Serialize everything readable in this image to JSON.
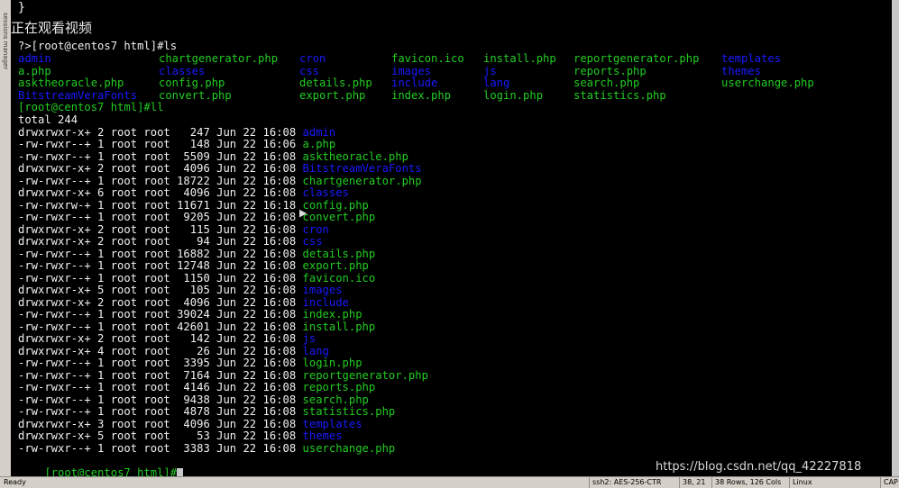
{
  "overlay_text": "正在观看视频",
  "left_strip_label": "sessions manager",
  "top_brace": "}",
  "prompt_ls": "?>[root@centos7 html]#ls",
  "ls_columns": [
    [
      {
        "t": "admin",
        "c": "b"
      },
      {
        "t": "a.php",
        "c": "g"
      },
      {
        "t": "asktheoracle.php",
        "c": "g"
      },
      {
        "t": "BitstreamVeraFonts",
        "c": "b"
      }
    ],
    [
      {
        "t": "chartgenerator.php",
        "c": "g"
      },
      {
        "t": "classes",
        "c": "b"
      },
      {
        "t": "config.php",
        "c": "g"
      },
      {
        "t": "convert.php",
        "c": "g"
      }
    ],
    [
      {
        "t": "cron",
        "c": "b"
      },
      {
        "t": "css",
        "c": "b"
      },
      {
        "t": "details.php",
        "c": "g"
      },
      {
        "t": "export.php",
        "c": "g"
      }
    ],
    [
      {
        "t": "favicon.ico",
        "c": "g"
      },
      {
        "t": "images",
        "c": "b"
      },
      {
        "t": "include",
        "c": "b"
      },
      {
        "t": "index.php",
        "c": "g"
      }
    ],
    [
      {
        "t": "install.php",
        "c": "g"
      },
      {
        "t": "js",
        "c": "b"
      },
      {
        "t": "lang",
        "c": "b"
      },
      {
        "t": "login.php",
        "c": "g"
      }
    ],
    [
      {
        "t": "reportgenerator.php",
        "c": "g"
      },
      {
        "t": "reports.php",
        "c": "g"
      },
      {
        "t": "search.php",
        "c": "g"
      },
      {
        "t": "statistics.php",
        "c": "g"
      }
    ],
    [
      {
        "t": "templates",
        "c": "b"
      },
      {
        "t": "themes",
        "c": "b"
      },
      {
        "t": "userchange.php",
        "c": "g"
      }
    ]
  ],
  "prompt_ll": "[root@centos7 html]#ll",
  "total": "total 244",
  "ll_rows": [
    {
      "perm": "drwxrwxr-x+",
      "links": "2",
      "user": "root",
      "group": "root",
      "size": "247",
      "date": "Jun 22 16:08",
      "name": "admin",
      "c": "b"
    },
    {
      "perm": "-rw-rwxr--+",
      "links": "1",
      "user": "root",
      "group": "root",
      "size": "148",
      "date": "Jun 22 16:06",
      "name": "a.php",
      "c": "g"
    },
    {
      "perm": "-rw-rwxr--+",
      "links": "1",
      "user": "root",
      "group": "root",
      "size": "5509",
      "date": "Jun 22 16:08",
      "name": "asktheoracle.php",
      "c": "g"
    },
    {
      "perm": "drwxrwxr-x+",
      "links": "2",
      "user": "root",
      "group": "root",
      "size": "4096",
      "date": "Jun 22 16:08",
      "name": "BitstreamVeraFonts",
      "c": "b"
    },
    {
      "perm": "-rw-rwxr--+",
      "links": "1",
      "user": "root",
      "group": "root",
      "size": "18722",
      "date": "Jun 22 16:08",
      "name": "chartgenerator.php",
      "c": "g"
    },
    {
      "perm": "drwxrwxr-x+",
      "links": "6",
      "user": "root",
      "group": "root",
      "size": "4096",
      "date": "Jun 22 16:08",
      "name": "classes",
      "c": "b"
    },
    {
      "perm": "-rw-rwxrw-+",
      "links": "1",
      "user": "root",
      "group": "root",
      "size": "11671",
      "date": "Jun 22 16:18",
      "name": "config.php",
      "c": "g"
    },
    {
      "perm": "-rw-rwxr--+",
      "links": "1",
      "user": "root",
      "group": "root",
      "size": "9205",
      "date": "Jun 22 16:08",
      "name": "convert.php",
      "c": "g"
    },
    {
      "perm": "drwxrwxr-x+",
      "links": "2",
      "user": "root",
      "group": "root",
      "size": "115",
      "date": "Jun 22 16:08",
      "name": "cron",
      "c": "b"
    },
    {
      "perm": "drwxrwxr-x+",
      "links": "2",
      "user": "root",
      "group": "root",
      "size": "94",
      "date": "Jun 22 16:08",
      "name": "css",
      "c": "b"
    },
    {
      "perm": "-rw-rwxr--+",
      "links": "1",
      "user": "root",
      "group": "root",
      "size": "16882",
      "date": "Jun 22 16:08",
      "name": "details.php",
      "c": "g"
    },
    {
      "perm": "-rw-rwxr--+",
      "links": "1",
      "user": "root",
      "group": "root",
      "size": "12748",
      "date": "Jun 22 16:08",
      "name": "export.php",
      "c": "g"
    },
    {
      "perm": "-rw-rwxr--+",
      "links": "1",
      "user": "root",
      "group": "root",
      "size": "1150",
      "date": "Jun 22 16:08",
      "name": "favicon.ico",
      "c": "g"
    },
    {
      "perm": "drwxrwxr-x+",
      "links": "5",
      "user": "root",
      "group": "root",
      "size": "105",
      "date": "Jun 22 16:08",
      "name": "images",
      "c": "b"
    },
    {
      "perm": "drwxrwxr-x+",
      "links": "2",
      "user": "root",
      "group": "root",
      "size": "4096",
      "date": "Jun 22 16:08",
      "name": "include",
      "c": "b"
    },
    {
      "perm": "-rw-rwxr--+",
      "links": "1",
      "user": "root",
      "group": "root",
      "size": "39024",
      "date": "Jun 22 16:08",
      "name": "index.php",
      "c": "g"
    },
    {
      "perm": "-rw-rwxr--+",
      "links": "1",
      "user": "root",
      "group": "root",
      "size": "42601",
      "date": "Jun 22 16:08",
      "name": "install.php",
      "c": "g"
    },
    {
      "perm": "drwxrwxr-x+",
      "links": "2",
      "user": "root",
      "group": "root",
      "size": "142",
      "date": "Jun 22 16:08",
      "name": "js",
      "c": "b"
    },
    {
      "perm": "drwxrwxr-x+",
      "links": "4",
      "user": "root",
      "group": "root",
      "size": "26",
      "date": "Jun 22 16:08",
      "name": "lang",
      "c": "b"
    },
    {
      "perm": "-rw-rwxr--+",
      "links": "1",
      "user": "root",
      "group": "root",
      "size": "3395",
      "date": "Jun 22 16:08",
      "name": "login.php",
      "c": "g"
    },
    {
      "perm": "-rw-rwxr--+",
      "links": "1",
      "user": "root",
      "group": "root",
      "size": "7164",
      "date": "Jun 22 16:08",
      "name": "reportgenerator.php",
      "c": "g"
    },
    {
      "perm": "-rw-rwxr--+",
      "links": "1",
      "user": "root",
      "group": "root",
      "size": "4146",
      "date": "Jun 22 16:08",
      "name": "reports.php",
      "c": "g"
    },
    {
      "perm": "-rw-rwxr--+",
      "links": "1",
      "user": "root",
      "group": "root",
      "size": "9438",
      "date": "Jun 22 16:08",
      "name": "search.php",
      "c": "g"
    },
    {
      "perm": "-rw-rwxr--+",
      "links": "1",
      "user": "root",
      "group": "root",
      "size": "4878",
      "date": "Jun 22 16:08",
      "name": "statistics.php",
      "c": "g"
    },
    {
      "perm": "drwxrwxr-x+",
      "links": "3",
      "user": "root",
      "group": "root",
      "size": "4096",
      "date": "Jun 22 16:08",
      "name": "templates",
      "c": "b"
    },
    {
      "perm": "drwxrwxr-x+",
      "links": "5",
      "user": "root",
      "group": "root",
      "size": "53",
      "date": "Jun 22 16:08",
      "name": "themes",
      "c": "b"
    },
    {
      "perm": "-rw-rwxr--+",
      "links": "1",
      "user": "root",
      "group": "root",
      "size": "3383",
      "date": "Jun 22 16:08",
      "name": "userchange.php",
      "c": "g"
    }
  ],
  "prompt_final": "[root@centos7 html]#",
  "watermark": "https://blog.csdn.net/qq_42227818",
  "status": {
    "ready": "Ready",
    "ssh": "ssh2: AES-256-CTR",
    "pos": "38, 21",
    "size": "38 Rows, 126 Cols",
    "os": "Linux",
    "cap": "CAP"
  },
  "colors": {
    "green": "#22cc22",
    "blue": "#1a1aff",
    "white": "#f0f0f0"
  }
}
